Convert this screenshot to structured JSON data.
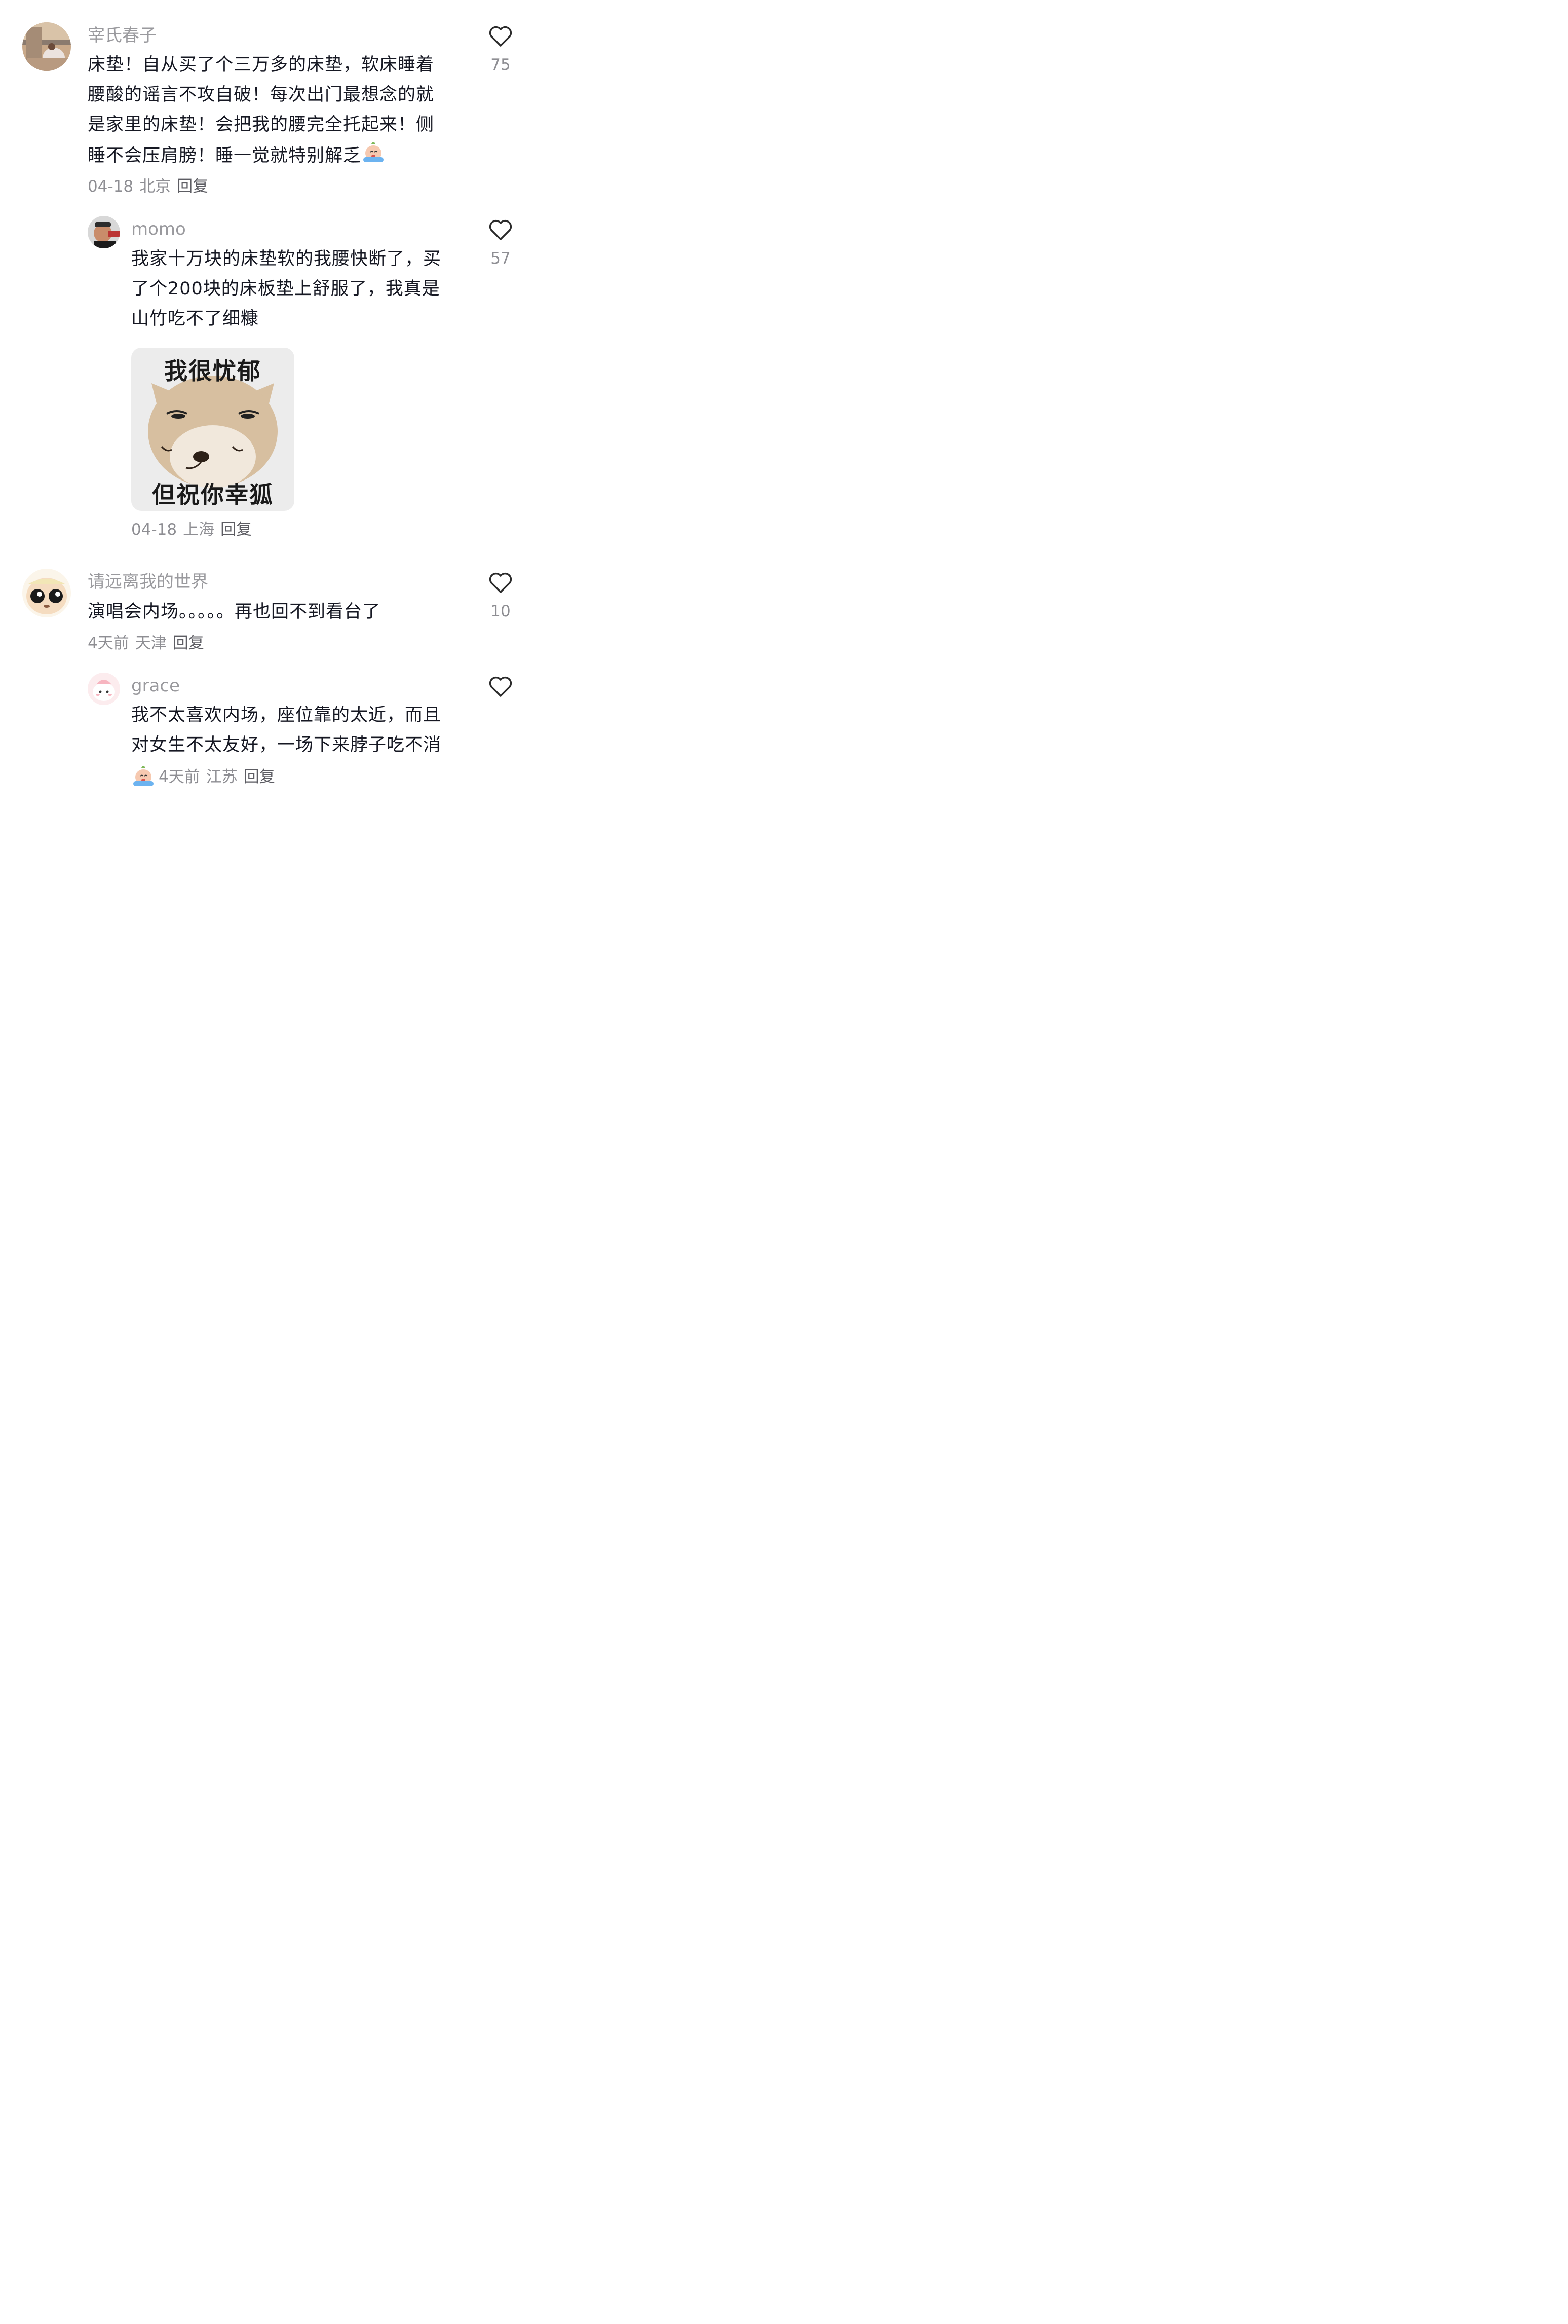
{
  "comments": [
    {
      "username": "宰氏春子",
      "lines": [
        "床垫！自从买了个三万多的床垫，软床睡着",
        "腰酸的谣言不攻自破！每次出门最想念的就",
        "是家里的床垫！会把我的腰完全托起来！侧",
        "睡不会压肩膀！睡一觉就特别解乏"
      ],
      "date": "04-18",
      "location": "北京",
      "reply_label": "回复",
      "likes": "75",
      "avatar_icon": "woman-by-window-photo",
      "trailing_emoji": "crying-peach-emoji"
    },
    {
      "username": "momo",
      "lines": [
        "我家十万块的床垫软的我腰快断了，买",
        "了个200块的床板垫上舒服了，我真是",
        "山竹吃不了细糠"
      ],
      "sticker": {
        "top_text": "我很忧郁",
        "bottom_text": "但祝你幸狐",
        "icon": "shiba-dog-meme"
      },
      "date": "04-18",
      "location": "上海",
      "reply_label": "回复",
      "likes": "57",
      "avatar_icon": "man-with-cap-photo"
    },
    {
      "username": "请远离我的世界",
      "lines": [
        "演唱会内场。。。。。再也回不到看台了"
      ],
      "date": "4天前",
      "location": "天津",
      "reply_label": "回复",
      "likes": "10",
      "avatar_icon": "cartoon-face-avatar"
    },
    {
      "username": "grace",
      "lines": [
        "我不太喜欢内场，座位靠的太近，而且",
        "对女生不太友好，一场下来脖子吃不消"
      ],
      "date": "4天前",
      "location": "江苏",
      "reply_label": "回复",
      "likes": "",
      "avatar_icon": "pink-cartoon-avatar",
      "leading_emoji": "crying-peach-emoji"
    }
  ],
  "colors": {
    "text": "#161823",
    "secondary": "#9a9a9e",
    "icon": "#2b2b2b"
  }
}
